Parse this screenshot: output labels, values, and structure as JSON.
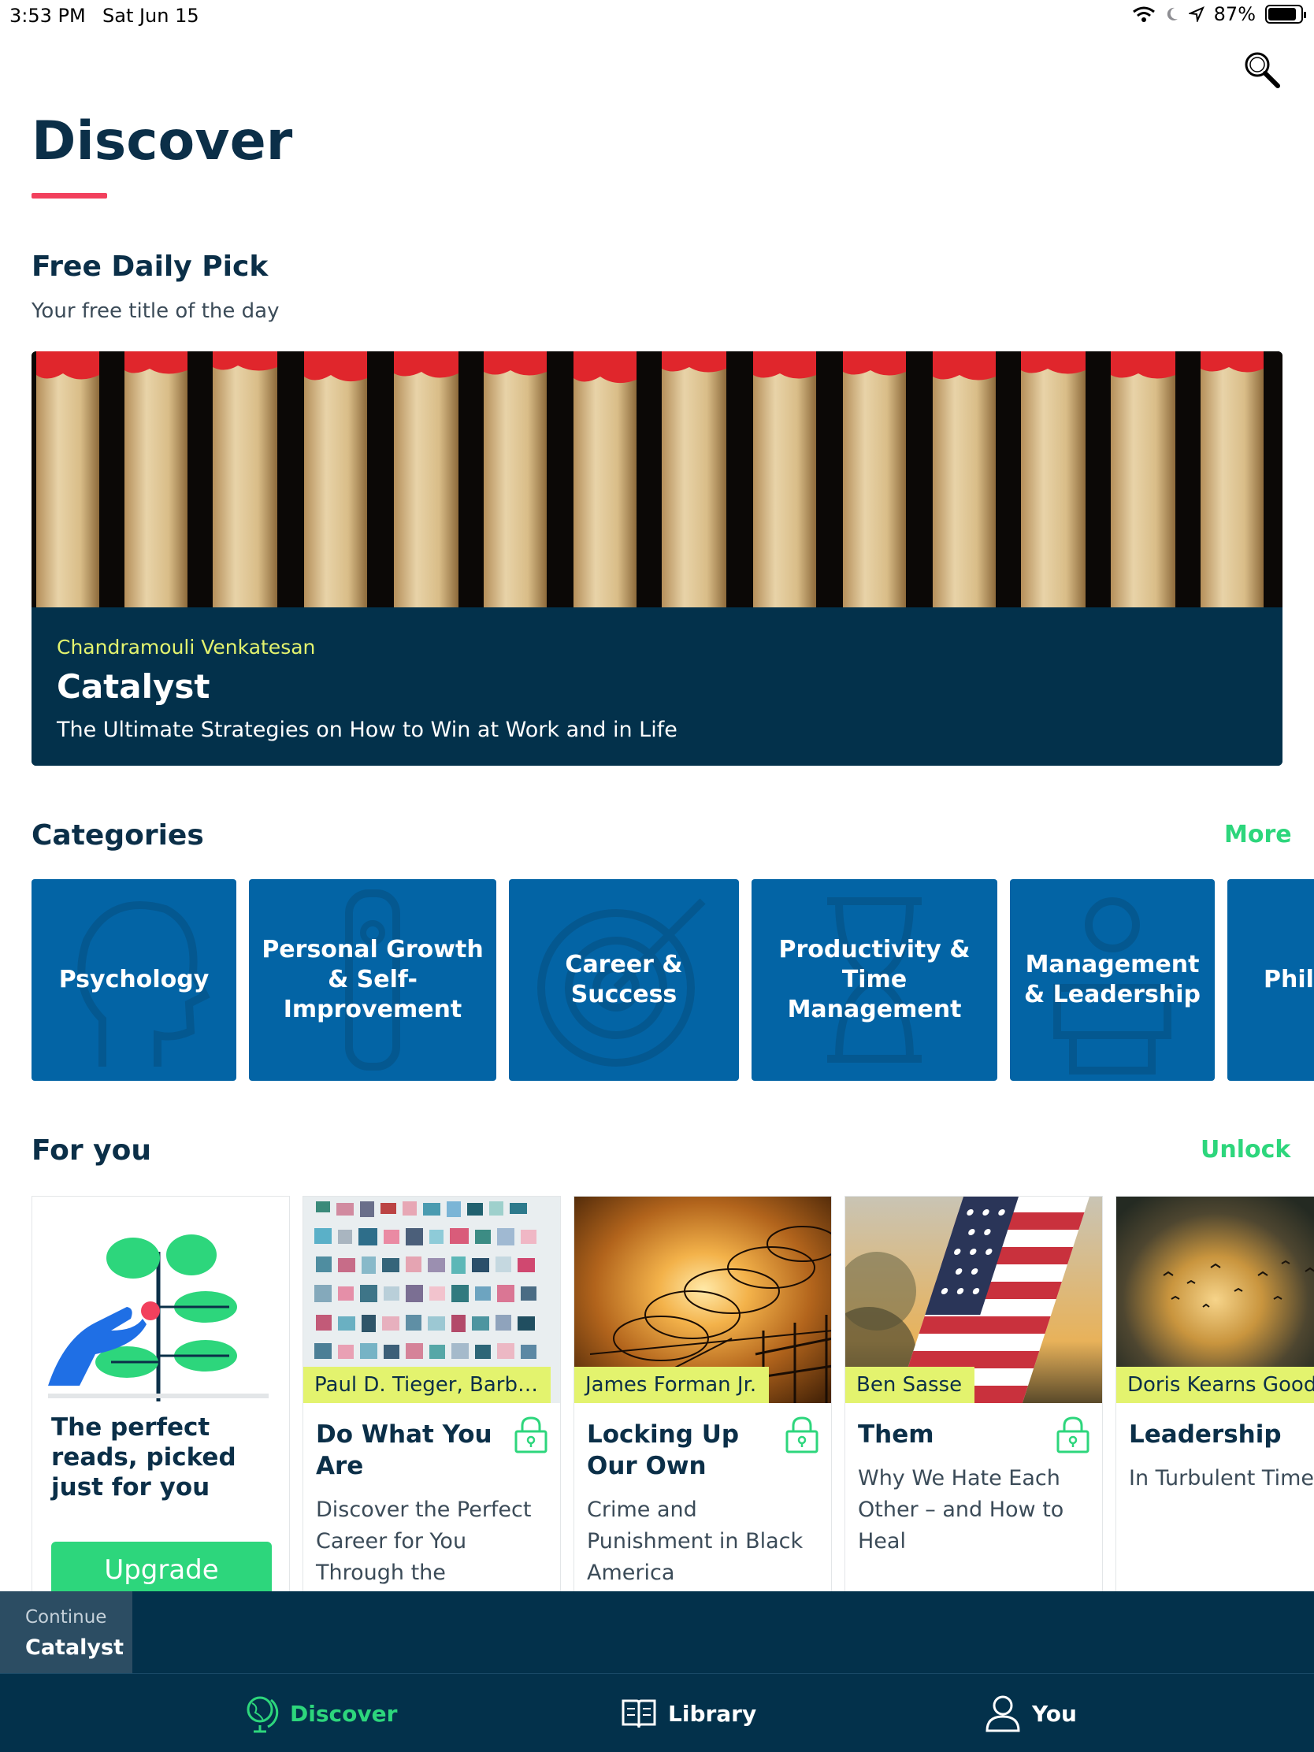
{
  "status_bar": {
    "time": "3:53 PM",
    "date": "Sat Jun 15",
    "battery": "87%"
  },
  "header": {
    "title": "Discover"
  },
  "daily_pick": {
    "section_title": "Free Daily Pick",
    "section_subtitle": "Your free title of the day",
    "author": "Chandramouli Venkatesan",
    "title": "Catalyst",
    "subtitle": "The Ultimate Strategies on How to Win at Work and in Life"
  },
  "categories": {
    "section_title": "Categories",
    "more_label": "More",
    "items": [
      {
        "label": "Psychology"
      },
      {
        "label": "Personal Growth & Self-Improvement"
      },
      {
        "label": "Career & Success"
      },
      {
        "label": "Productivity & Time Management"
      },
      {
        "label": "Management & Leadership"
      },
      {
        "label": "Phil"
      }
    ]
  },
  "for_you": {
    "section_title": "For you",
    "unlock_label": "Unlock",
    "promo": {
      "text": "The perfect reads, picked just for you",
      "button": "Upgrade"
    },
    "books": [
      {
        "author": "Paul D. Tieger, Barb…",
        "title": "Do What You Are",
        "description": "Discover the Perfect Career for You Through the Secrets…",
        "locked": true
      },
      {
        "author": "James Forman Jr.",
        "title": "Locking Up Our Own",
        "description": "Crime and Punishment in Black America",
        "locked": true
      },
      {
        "author": "Ben Sasse",
        "title": "Them",
        "description": "Why We Hate Each Other – and How to Heal",
        "locked": true
      },
      {
        "author": "Doris Kearns Good",
        "title": "Leadership",
        "description": "In Turbulent Times",
        "locked": false
      }
    ]
  },
  "continue": {
    "label": "Continue",
    "title": "Catalyst"
  },
  "tabs": [
    {
      "label": "Discover",
      "active": true
    },
    {
      "label": "Library",
      "active": false
    },
    {
      "label": "You",
      "active": false
    }
  ],
  "colors": {
    "navy": "#03314b",
    "accent_green": "#2dd67c",
    "accent_red": "#f2405d",
    "category_blue": "#0364a5",
    "author_tag": "#e3f36e"
  }
}
